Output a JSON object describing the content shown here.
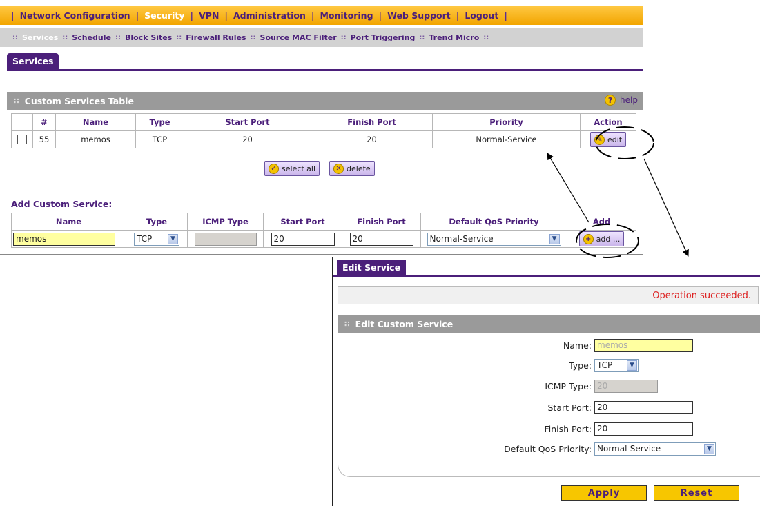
{
  "main_nav": {
    "items": [
      {
        "label": "Network Configuration",
        "active": false
      },
      {
        "label": "Security",
        "active": true
      },
      {
        "label": "VPN",
        "active": false
      },
      {
        "label": "Administration",
        "active": false
      },
      {
        "label": "Monitoring",
        "active": false
      },
      {
        "label": "Web Support",
        "active": false
      },
      {
        "label": "Logout",
        "active": false
      }
    ]
  },
  "sub_nav": {
    "items": [
      {
        "label": "Services",
        "active": true
      },
      {
        "label": "Schedule",
        "active": false
      },
      {
        "label": "Block Sites",
        "active": false
      },
      {
        "label": "Firewall Rules",
        "active": false
      },
      {
        "label": "Source MAC Filter",
        "active": false
      },
      {
        "label": "Port Triggering",
        "active": false
      },
      {
        "label": "Trend Micro",
        "active": false
      }
    ]
  },
  "page_tab": "Services",
  "custom_table": {
    "title": "Custom Services Table",
    "help_label": "help",
    "headers": [
      "#",
      "Name",
      "Type",
      "Start Port",
      "Finish Port",
      "Priority",
      "Action"
    ],
    "rows": [
      {
        "num": "55",
        "name": "memos",
        "type": "TCP",
        "start": "20",
        "finish": "20",
        "priority": "Normal-Service",
        "action": "edit"
      }
    ],
    "select_all_label": "select all",
    "delete_label": "delete"
  },
  "add_section": {
    "label": "Add Custom Service:",
    "headers": [
      "Name",
      "Type",
      "ICMP Type",
      "Start Port",
      "Finish Port",
      "Default QoS Priority",
      "Add"
    ],
    "name_value": "memos",
    "type_value": "TCP",
    "icmp_value": "",
    "start_value": "20",
    "finish_value": "20",
    "priority_value": "Normal-Service",
    "add_label": "add ..."
  },
  "edit_panel": {
    "tab": "Edit Service",
    "status": "Operation succeeded.",
    "section_title": "Edit Custom Service",
    "fields": {
      "name_label": "Name:",
      "name_value": "memos",
      "type_label": "Type:",
      "type_value": "TCP",
      "icmp_label": "ICMP Type:",
      "icmp_value": "20",
      "start_label": "Start Port:",
      "start_value": "20",
      "finish_label": "Finish Port:",
      "finish_value": "20",
      "priority_label": "Default QoS Priority:",
      "priority_value": "Normal-Service"
    },
    "apply_label": "Apply",
    "reset_label": "Reset"
  },
  "icons": {
    "help": "help-icon",
    "select_all": "check-circle-icon",
    "delete": "x-circle-icon",
    "edit": "pencil-icon",
    "add": "plus-circle-icon",
    "dropdown": "chevron-down-icon"
  },
  "colors": {
    "brand_purple": "#4b1f7a",
    "nav_orange": "#f2a500",
    "section_grey": "#9a9a9a",
    "highlight_yellow": "#ffffa0",
    "status_red": "#dd2222",
    "button_yellow": "#f7c600"
  }
}
